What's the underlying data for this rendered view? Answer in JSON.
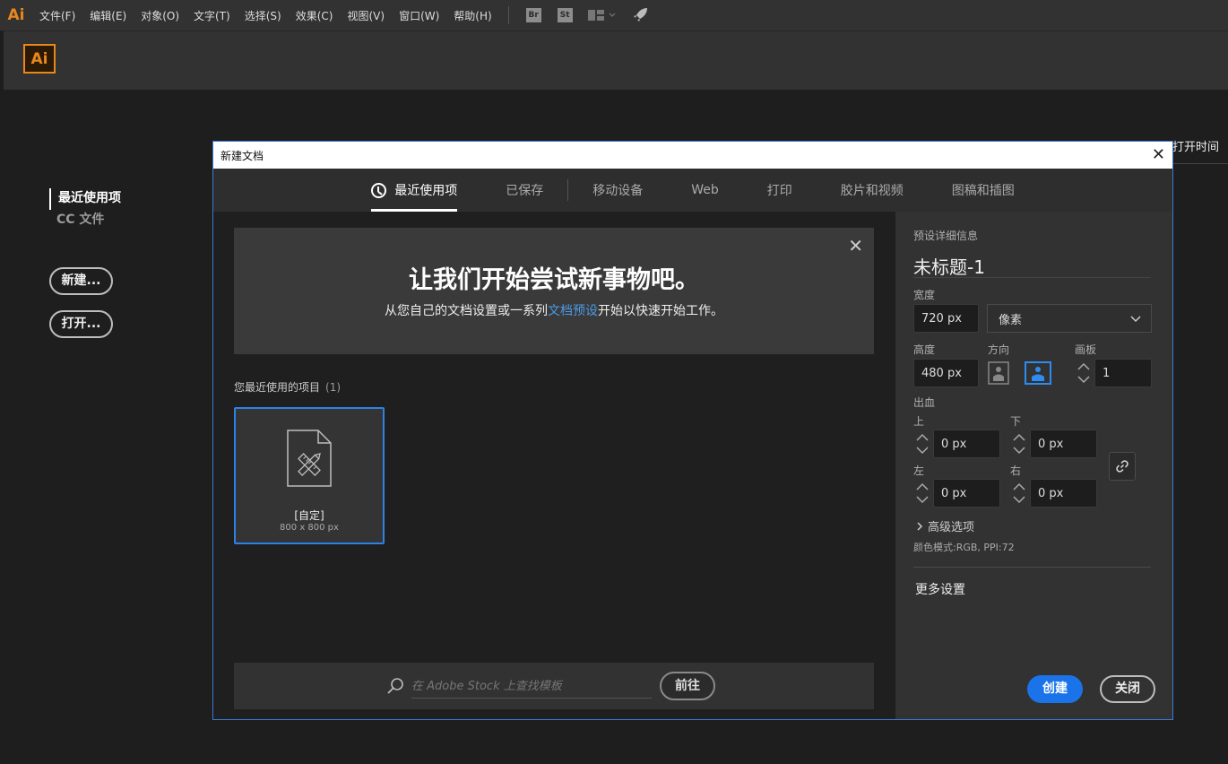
{
  "app": {
    "logo": "Ai"
  },
  "menu": [
    "文件(F)",
    "编辑(E)",
    "对象(O)",
    "文字(T)",
    "选择(S)",
    "效果(C)",
    "视图(V)",
    "窗口(W)",
    "帮助(H)"
  ],
  "toolbar": {
    "bridge": "Br",
    "stock": "St"
  },
  "home": {
    "nav": [
      "最近使用项",
      "CC 文件"
    ],
    "new_button": "新建...",
    "open_button": "打开...",
    "column_header": "打开时间"
  },
  "dialog": {
    "title": "新建文档",
    "tabs": [
      "最近使用项",
      "已保存",
      "移动设备",
      "Web",
      "打印",
      "胶片和视频",
      "图稿和插图"
    ],
    "banner": {
      "title": "让我们开始尝试新事物吧。",
      "sub_pre": "从您自己的文档设置或一系列",
      "sub_link": "文档预设",
      "sub_post": "开始以快速开始工作。"
    },
    "recent_label": "您最近使用的项目",
    "recent_count": "(1)",
    "preset": {
      "name": "[自定]",
      "size": "800 x 800 px"
    },
    "stock": {
      "placeholder": "在 Adobe Stock 上查找模板",
      "go": "前往"
    },
    "details": {
      "header": "预设详细信息",
      "doc_name": "未标题-1",
      "width_label": "宽度",
      "width": "720 px",
      "unit": "像素",
      "height_label": "高度",
      "height": "480 px",
      "orientation_label": "方向",
      "artboard_label": "画板",
      "artboards": "1",
      "bleed_label": "出血",
      "top_label": "上",
      "bottom_label": "下",
      "left_label": "左",
      "right_label": "右",
      "bleed_top": "0 px",
      "bleed_bottom": "0 px",
      "bleed_left": "0 px",
      "bleed_right": "0 px",
      "advanced": "高级选项",
      "color_info": "颜色模式:RGB, PPI:72",
      "more": "更多设置",
      "create": "创建",
      "close": "关闭"
    }
  }
}
